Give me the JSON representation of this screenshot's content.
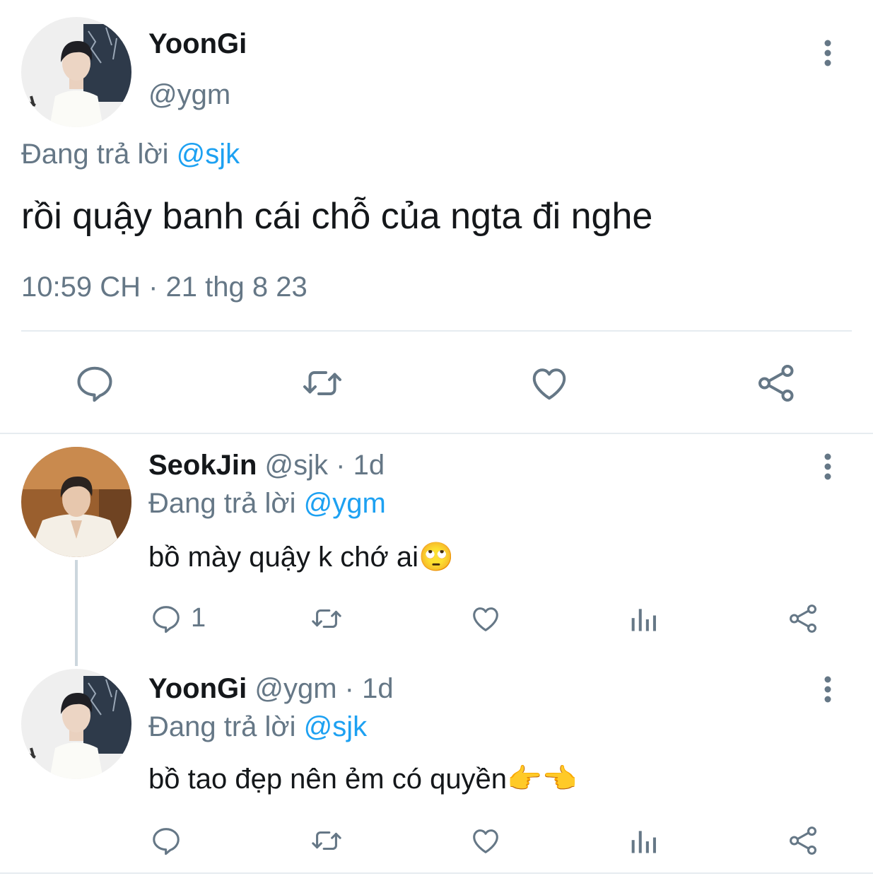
{
  "main_tweet": {
    "display_name": "YoonGi",
    "handle": "@ygm",
    "reply_prefix": "Đang trả lời",
    "reply_to": "@sjk",
    "text": "rồi quậy banh cái chỗ của ngta đi nghe",
    "timestamp": "10:59 CH · 21 thg 8 23"
  },
  "replies": [
    {
      "display_name": "SeokJin",
      "handle": "@sjk",
      "time": "· 1d",
      "reply_prefix": "Đang trả lời",
      "reply_to": "@ygm",
      "text": "bồ mày quậy k chớ ai🙄",
      "reply_count": "1"
    },
    {
      "display_name": "YoonGi",
      "handle": "@ygm",
      "time": "· 1d",
      "reply_prefix": "Đang trả lời",
      "reply_to": "@sjk",
      "text": "bồ tao đẹp nên ẻm có quyền👉👈",
      "reply_count": ""
    }
  ],
  "icons": {
    "reply": "speech-bubble-icon",
    "retweet": "retweet-icon",
    "like": "heart-icon",
    "share": "share-icon",
    "analytics": "bar-chart-icon",
    "more": "vertical-dots-icon"
  },
  "colors": {
    "link": "#1da1f2",
    "secondary_text": "#657786",
    "divider": "#e6ecf0"
  }
}
